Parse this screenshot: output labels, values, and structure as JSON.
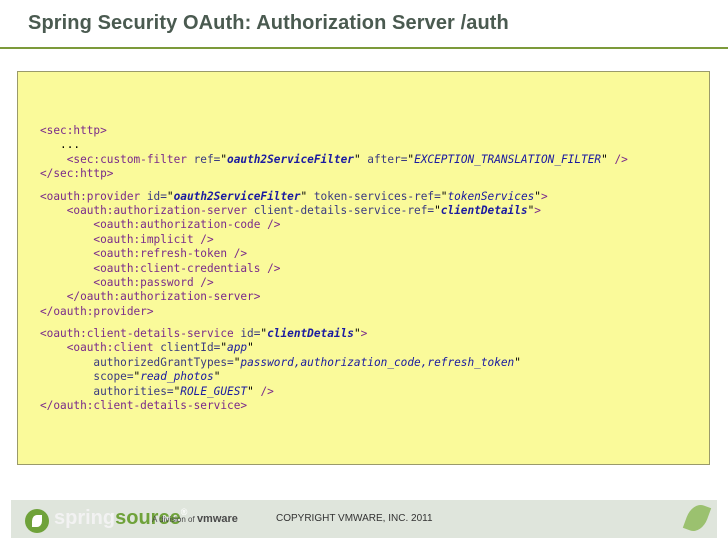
{
  "title": "Spring Security OAuth: Authorization Server /auth",
  "code_lines": [
    [
      [
        "t",
        "<sec:http>"
      ]
    ],
    [
      [
        "p",
        "   ..."
      ]
    ],
    [
      [
        "t",
        "    <sec:custom-filter "
      ],
      [
        "a",
        "ref="
      ],
      [
        "p",
        "\""
      ],
      [
        "v",
        "oauth2ServiceFilter"
      ],
      [
        "p",
        "\" "
      ],
      [
        "a",
        "after="
      ],
      [
        "p",
        "\""
      ],
      [
        "vi",
        "EXCEPTION_TRANSLATION_FILTER"
      ],
      [
        "p",
        "\" "
      ],
      [
        "t",
        "/>"
      ]
    ],
    [
      [
        "t",
        "</sec:http>"
      ]
    ],
    "gap",
    [
      [
        "t",
        "<oauth:provider "
      ],
      [
        "a",
        "id="
      ],
      [
        "p",
        "\""
      ],
      [
        "v",
        "oauth2ServiceFilter"
      ],
      [
        "p",
        "\" "
      ],
      [
        "a",
        "token-services-ref="
      ],
      [
        "p",
        "\""
      ],
      [
        "vi",
        "tokenServices"
      ],
      [
        "p",
        "\""
      ],
      [
        "t",
        ">"
      ]
    ],
    [
      [
        "t",
        "    <oauth:authorization-server "
      ],
      [
        "a",
        "client-details-service-ref="
      ],
      [
        "p",
        "\""
      ],
      [
        "v",
        "clientDetails"
      ],
      [
        "p",
        "\""
      ],
      [
        "t",
        ">"
      ]
    ],
    [
      [
        "t",
        "        <oauth:authorization-code />"
      ]
    ],
    [
      [
        "t",
        "        <oauth:implicit />"
      ]
    ],
    [
      [
        "t",
        "        <oauth:refresh-token />"
      ]
    ],
    [
      [
        "t",
        "        <oauth:client-credentials />"
      ]
    ],
    [
      [
        "t",
        "        <oauth:password />"
      ]
    ],
    [
      [
        "t",
        "    </oauth:authorization-server>"
      ]
    ],
    [
      [
        "t",
        "</oauth:provider>"
      ]
    ],
    "gap",
    [
      [
        "t",
        "<oauth:client-details-service "
      ],
      [
        "a",
        "id="
      ],
      [
        "p",
        "\""
      ],
      [
        "v",
        "clientDetails"
      ],
      [
        "p",
        "\""
      ],
      [
        "t",
        ">"
      ]
    ],
    [
      [
        "t",
        "    <oauth:client "
      ],
      [
        "a",
        "clientId="
      ],
      [
        "p",
        "\""
      ],
      [
        "vi",
        "app"
      ],
      [
        "p",
        "\""
      ]
    ],
    [
      [
        "a",
        "        authorizedGrantTypes="
      ],
      [
        "p",
        "\""
      ],
      [
        "vi",
        "password,authorization_code,refresh_token"
      ],
      [
        "p",
        "\""
      ]
    ],
    [
      [
        "a",
        "        scope="
      ],
      [
        "p",
        "\""
      ],
      [
        "vi",
        "read_photos"
      ],
      [
        "p",
        "\""
      ]
    ],
    [
      [
        "a",
        "        authorities="
      ],
      [
        "p",
        "\""
      ],
      [
        "vi",
        "ROLE_GUEST"
      ],
      [
        "p",
        "\" "
      ],
      [
        "t",
        "/>"
      ]
    ],
    [
      [
        "t",
        "</oauth:client-details-service>"
      ]
    ]
  ],
  "footer": {
    "brand_part1": "spring",
    "brand_part2": "source",
    "trademark": "®",
    "division_text": "A division of",
    "division_brand": "vmware",
    "copyright": "COPYRIGHT VMWARE, INC. 2011"
  }
}
